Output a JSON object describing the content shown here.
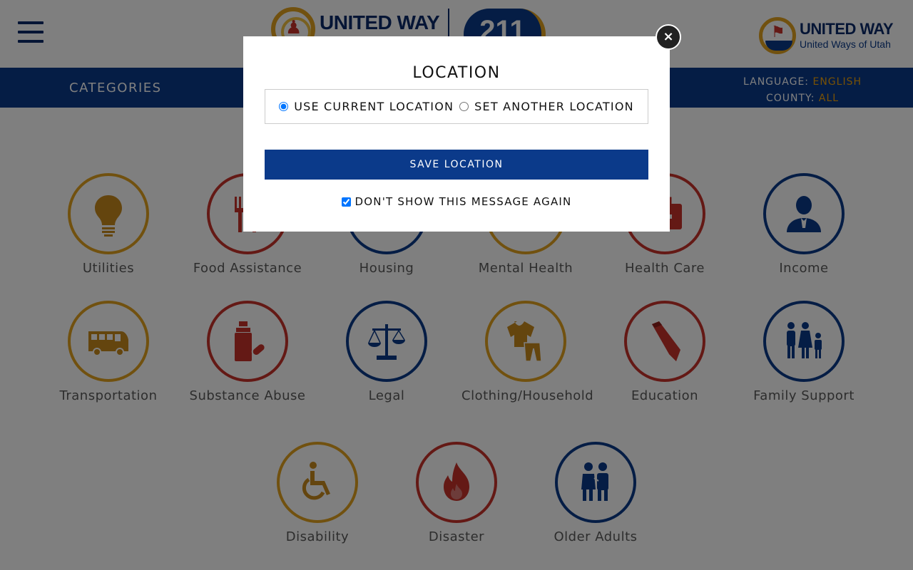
{
  "header": {
    "logo_center_text": "UNITED WAY",
    "badge_text": "211",
    "logo_right_title": "UNITED WAY",
    "logo_right_subtitle": "United Ways of Utah"
  },
  "nav": {
    "categories_label": "CATEGORIES",
    "language_label": "LANGUAGE:",
    "language_value": "ENGLISH",
    "county_label": "COUNTY:",
    "county_value": "ALL"
  },
  "colors": {
    "gold": "#e3a21f",
    "red": "#c8322b",
    "navy": "#0b3a8a"
  },
  "categories": [
    {
      "label": "Utilities",
      "icon": "lightbulb-icon",
      "color": "gold"
    },
    {
      "label": "Food Assistance",
      "icon": "fork-knife-icon",
      "color": "red"
    },
    {
      "label": "Housing",
      "icon": "house-icon",
      "color": "navy"
    },
    {
      "label": "Mental Health",
      "icon": "brain-icon",
      "color": "gold"
    },
    {
      "label": "Health Care",
      "icon": "medical-kit-icon",
      "color": "red"
    },
    {
      "label": "Income",
      "icon": "businessman-icon",
      "color": "navy"
    },
    {
      "label": "Transportation",
      "icon": "bus-icon",
      "color": "gold"
    },
    {
      "label": "Substance Abuse",
      "icon": "bottle-pill-icon",
      "color": "red"
    },
    {
      "label": "Legal",
      "icon": "scales-icon",
      "color": "navy"
    },
    {
      "label": "Clothing/Household",
      "icon": "clothing-icon",
      "color": "gold"
    },
    {
      "label": "Education",
      "icon": "pencil-icon",
      "color": "red"
    },
    {
      "label": "Family Support",
      "icon": "family-icon",
      "color": "navy"
    },
    {
      "label": "Disability",
      "icon": "wheelchair-icon",
      "color": "gold"
    },
    {
      "label": "Disaster",
      "icon": "fire-icon",
      "color": "red"
    },
    {
      "label": "Older Adults",
      "icon": "elderly-couple-icon",
      "color": "navy"
    }
  ],
  "modal": {
    "title": "LOCATION",
    "option_current": "USE CURRENT LOCATION",
    "option_other": "SET ANOTHER LOCATION",
    "save_label": "SAVE LOCATION",
    "dont_show_label": "DON'T SHOW THIS MESSAGE AGAIN",
    "close_glyph": "×",
    "current_selected": true,
    "dont_show_checked": true
  }
}
